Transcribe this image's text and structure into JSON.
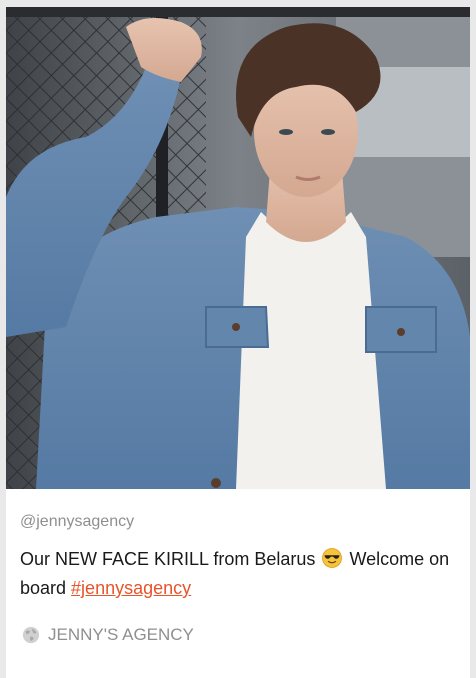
{
  "post": {
    "image_icon": "model-photo",
    "handle": "@jennysagency",
    "caption_text": "Our NEW FACE KIRILL from Belarus",
    "caption_emoji": "smiling-face-with-sunglasses",
    "caption_after_emoji": " Welcome on board ",
    "hashtag": "#jennysagency",
    "source_icon": "globe-icon",
    "source_label": "JENNY'S AGENCY"
  },
  "colors": {
    "hashtag": "#e8542a",
    "muted_text": "#8f8f8f",
    "body_text": "#1a1a1a"
  }
}
